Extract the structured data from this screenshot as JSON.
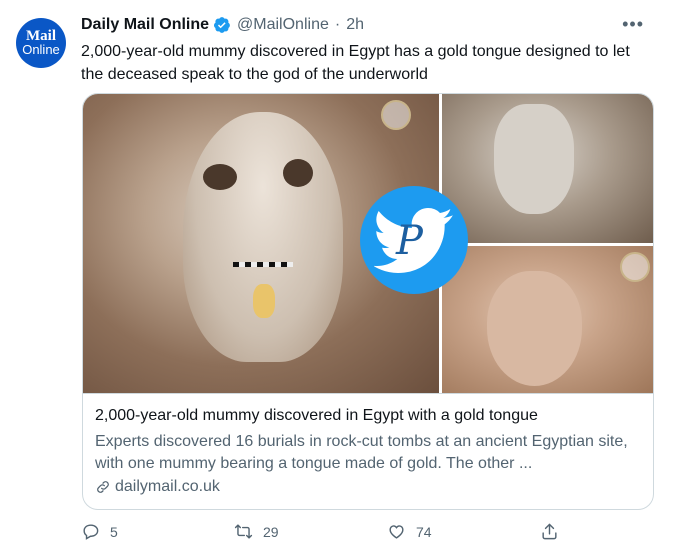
{
  "tweet": {
    "avatar": {
      "line1": "Mail",
      "line2": "Online"
    },
    "name": "Daily Mail Online",
    "handle": "@MailOnline",
    "separator": "·",
    "time": "2h",
    "text": "2,000-year-old mummy discovered in Egypt has a gold tongue designed to let the deceased speak to the god of the underworld",
    "more_icon": "more-dots-icon"
  },
  "card": {
    "title": "2,000-year-old mummy discovered in Egypt with a gold tongue",
    "description": "Experts discovered 16 burials in rock-cut tombs at an ancient Egyptian site, with one mummy bearing a tongue made of gold. The other ...",
    "domain": "dailymail.co.uk",
    "watermark_letter": "P"
  },
  "actions": {
    "replies": "5",
    "retweets": "29",
    "likes": "74"
  },
  "colors": {
    "accent": "#1d9bf0",
    "text_secondary": "#536471",
    "border": "#cfd9de"
  }
}
